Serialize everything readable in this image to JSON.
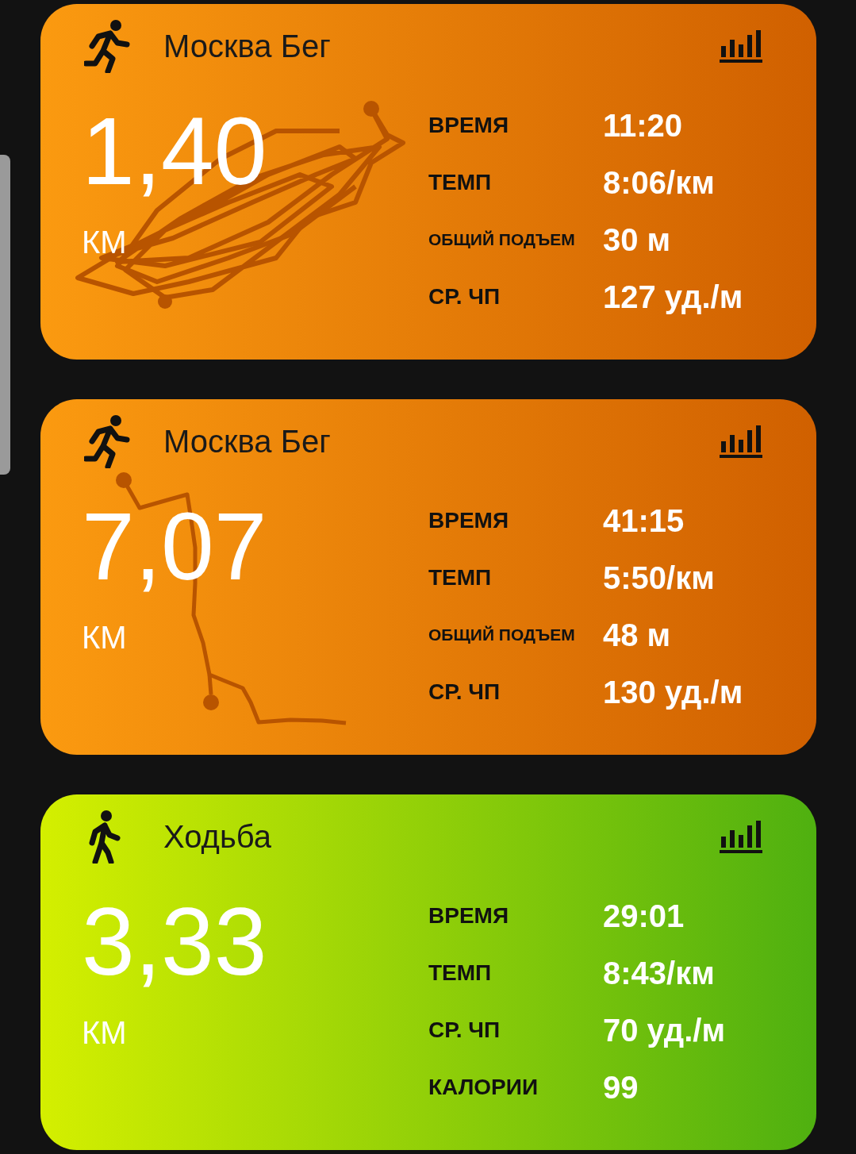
{
  "activities": [
    {
      "kind": "run",
      "title": "Москва Бег",
      "distance": "1,40",
      "unit": "КМ",
      "stats": [
        {
          "label": "ВРЕМЯ",
          "value": "11:20"
        },
        {
          "label": "ТЕМП",
          "value": "8:06/км"
        },
        {
          "label": "ОБЩИЙ ПОДЪЕМ",
          "value": "30 м"
        },
        {
          "label": "СР. ЧП",
          "value": "127 уд./м"
        }
      ]
    },
    {
      "kind": "run",
      "title": "Москва Бег",
      "distance": "7,07",
      "unit": "КМ",
      "stats": [
        {
          "label": "ВРЕМЯ",
          "value": "41:15"
        },
        {
          "label": "ТЕМП",
          "value": "5:50/км"
        },
        {
          "label": "ОБЩИЙ ПОДЪЕМ",
          "value": "48 м"
        },
        {
          "label": "СР. ЧП",
          "value": "130 уд./м"
        }
      ]
    },
    {
      "kind": "walk",
      "title": "Ходьба",
      "distance": "3,33",
      "unit": "КМ",
      "stats": [
        {
          "label": "ВРЕМЯ",
          "value": "29:01"
        },
        {
          "label": "ТЕМП",
          "value": "8:43/км"
        },
        {
          "label": "СР. ЧП",
          "value": "70 уд./м"
        },
        {
          "label": "КАЛОРИИ",
          "value": "99"
        }
      ]
    }
  ]
}
